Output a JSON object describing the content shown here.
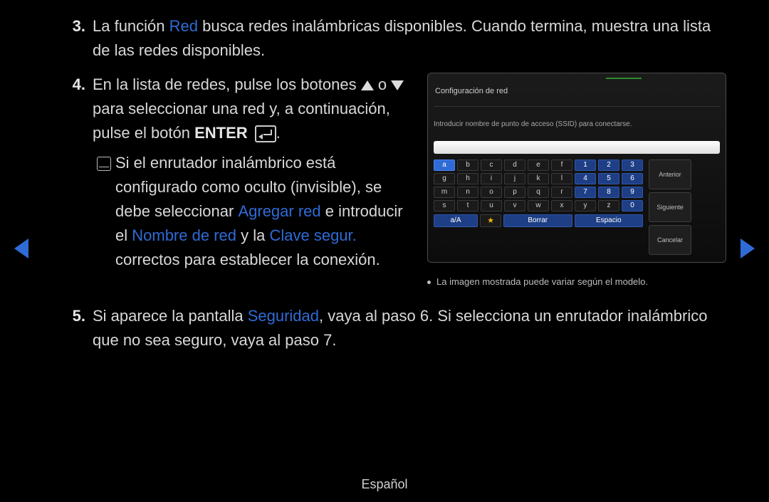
{
  "steps": {
    "s3": {
      "num": "3.",
      "t1": "La función ",
      "red": "Red",
      "t2": " busca redes inalámbricas disponibles. Cuando termina, muestra una lista de las redes disponibles."
    },
    "s4": {
      "num": "4.",
      "t1": "En la lista de redes, pulse los botones ",
      "o": " o ",
      "t2": " para seleccionar una red y, a continuación, pulse el botón ",
      "enter": "ENTER",
      "period": "."
    },
    "note": {
      "t1": "Si el enrutador inalámbrico está configurado como oculto (invisible), se debe seleccionar ",
      "agregar": "Agregar red",
      "t2": " e introducir el ",
      "nombre": "Nombre de red",
      "t3": " y la ",
      "clave": "Clave segur.",
      "t4": " correctos para establecer la conexión."
    },
    "s5": {
      "num": "5.",
      "t1": "Si aparece la pantalla ",
      "seguridad": "Seguridad",
      "t2": ", vaya al paso 6. Si selecciona un enrutador inalámbrico que no sea seguro, vaya al paso 7."
    }
  },
  "kb": {
    "title": "Configuración de red",
    "msg": "Introducir nombre de punto de acceso (SSID) para conectarse.",
    "rows": [
      [
        "a",
        "b",
        "c",
        "d",
        "e",
        "f",
        "1",
        "2",
        "3"
      ],
      [
        "g",
        "h",
        "i",
        "j",
        "k",
        "l",
        "4",
        "5",
        "6"
      ],
      [
        "m",
        "n",
        "o",
        "p",
        "q",
        "r",
        "7",
        "8",
        "9"
      ],
      [
        "s",
        "t",
        "u",
        "v",
        "w",
        "x",
        "y",
        "z",
        "0"
      ]
    ],
    "side": {
      "prev": "Anterior",
      "next": "Siguiente",
      "cancel": "Cancelar"
    },
    "actions": {
      "shift": "a/A",
      "delete": "Borrar",
      "space": "Espacio"
    },
    "caption": "La imagen mostrada puede variar según el modelo."
  },
  "footer": "Español"
}
